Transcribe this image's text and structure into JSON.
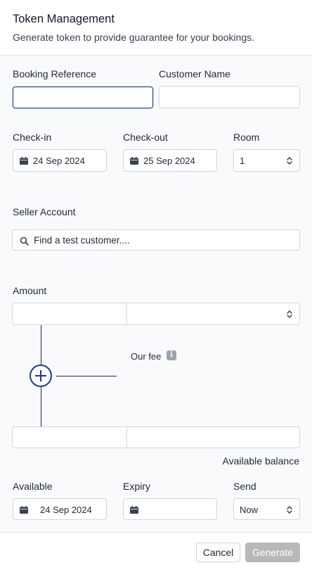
{
  "header": {
    "title": "Token Management",
    "subtitle": "Generate token to provide guarantee for your bookings."
  },
  "booking": {
    "reference_label": "Booking Reference",
    "reference_value": "",
    "customer_label": "Customer Name",
    "customer_value": ""
  },
  "stay": {
    "checkin_label": "Check-in",
    "checkin_value": "24 Sep 2024",
    "checkout_label": "Check-out",
    "checkout_value": "25 Sep 2024",
    "room_label": "Room",
    "room_value": "1"
  },
  "seller": {
    "label": "Seller Account",
    "placeholder": "Find a test customer...."
  },
  "amount": {
    "label": "Amount",
    "amount_value": "",
    "currency_value": "",
    "fee_label": "Our fee",
    "fee_info_glyph": "i",
    "result_value": "",
    "result_currency": "",
    "available_balance_label": "Available balance"
  },
  "schedule": {
    "available_label": "Available",
    "available_value": "24 Sep 2024",
    "expiry_label": "Expiry",
    "expiry_value": "",
    "send_label": "Send",
    "send_value": "Now"
  },
  "footer": {
    "cancel_label": "Cancel",
    "generate_label": "Generate"
  },
  "icons": {
    "calendar": "calendar-icon",
    "chevron": "chevron-updown-icon",
    "search": "search-icon",
    "info": "info-icon",
    "plus": "plus-circle-icon"
  },
  "colors": {
    "accent": "#1e3a8a",
    "disabled_button": "#b8b8b8",
    "panel_bg": "#f9fafb"
  }
}
